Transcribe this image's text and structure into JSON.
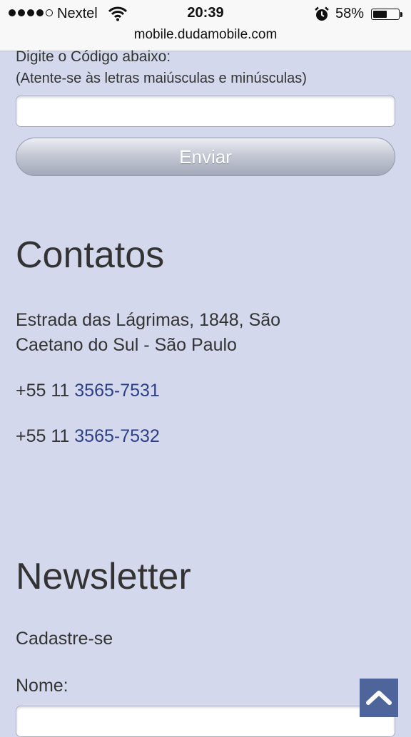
{
  "status_bar": {
    "carrier": "Nextel",
    "time": "20:39",
    "battery_percent": "58%",
    "battery_level": 0.58,
    "signal_bars_filled": 4,
    "signal_bars_total": 5,
    "url": "mobile.dudamobile.com"
  },
  "form": {
    "code_label": "Digite o Código abaixo:",
    "code_hint": "(Atente-se às letras maiúsculas e minúsculas)",
    "code_value": "",
    "submit_label": "Enviar"
  },
  "contacts": {
    "title": "Contatos",
    "address": "Estrada das Lágrimas, 1848, São Caetano do Sul - São Paulo",
    "phones": [
      {
        "prefix": "+55 11 ",
        "number": "3565-7531"
      },
      {
        "prefix": "+55 11 ",
        "number": "3565-7532"
      }
    ]
  },
  "newsletter": {
    "title": "Newsletter",
    "subtitle": "Cadastre-se",
    "name_label": "Nome:",
    "name_value": ""
  },
  "colors": {
    "background": "#d3d8ec",
    "link": "#2e3f86",
    "back_to_top": "#4d659a"
  },
  "icons": {
    "back_to_top": "chevron-up-icon",
    "wifi": "wifi-icon",
    "alarm": "alarm-clock-icon",
    "battery": "battery-icon"
  }
}
